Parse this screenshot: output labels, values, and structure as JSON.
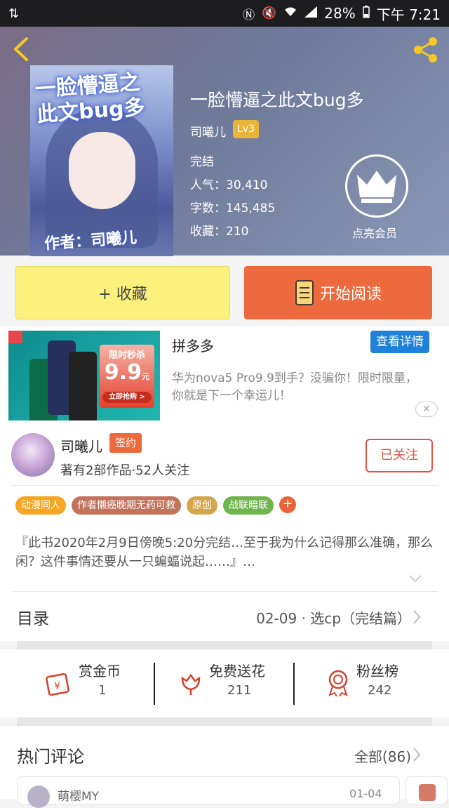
{
  "status_bar": {
    "battery": "28%",
    "time": "下午 7:21"
  },
  "book": {
    "title": "一脸懵逼之此文bug多",
    "author": "司曦儿",
    "level": "Lv3",
    "status": "完结",
    "popularity": "人气：30,410",
    "word_count": "字数：145,485",
    "favorites": "收藏：210",
    "cover_title_line1": "一脸懵逼之",
    "cover_title_line2": "此文bug多",
    "cover_author": "作者：司曦儿"
  },
  "vip": {
    "label": "点亮会员"
  },
  "actions": {
    "favorite_label": "+ 收藏",
    "read_label": "开始阅读"
  },
  "ad": {
    "brand": "拼多多",
    "button": "查看详情",
    "description": "华为nova5 Pro9.9到手？没骗你！限时限量，你就是下一个幸运儿！",
    "sale_line1": "限时秒杀",
    "sale_price": "9.9",
    "sale_unit": "元",
    "sale_cta": "立即抢购 >",
    "close": "✕"
  },
  "author_card": {
    "name": "司曦儿",
    "badge": "签约",
    "stats": "著有2部作品·52人关注",
    "follow_label": "已关注"
  },
  "tags": [
    {
      "label": "动漫同人",
      "bg": "#f5a623"
    },
    {
      "label": "作者懒癌晚期无药可救",
      "bg": "#c2735c"
    },
    {
      "label": "原创",
      "bg": "#d4a64b"
    },
    {
      "label": "战联暗联",
      "bg": "#6fb54e"
    }
  ],
  "tag_add": "+",
  "description": "『此书2020年2月9日傍晚5:20分完结…至于我为什么记得那么准确，那么闲？这件事情还要从一只蝙蝠说起……』…",
  "toc": {
    "label": "目录",
    "latest": "02-09 · 选cp（完结篇）"
  },
  "stats": [
    {
      "label": "赏金币",
      "value": "1"
    },
    {
      "label": "免费送花",
      "value": "211"
    },
    {
      "label": "粉丝榜",
      "value": "242"
    }
  ],
  "comments": {
    "title": "热门评论",
    "all_label": "全部(86)",
    "first_user": "萌樱MY",
    "first_date": "01-04"
  },
  "colors": {
    "accent": "#ec6a3d",
    "favorite": "#fdf17d",
    "follow": "#e05546",
    "ad_button": "#1f82d8"
  }
}
